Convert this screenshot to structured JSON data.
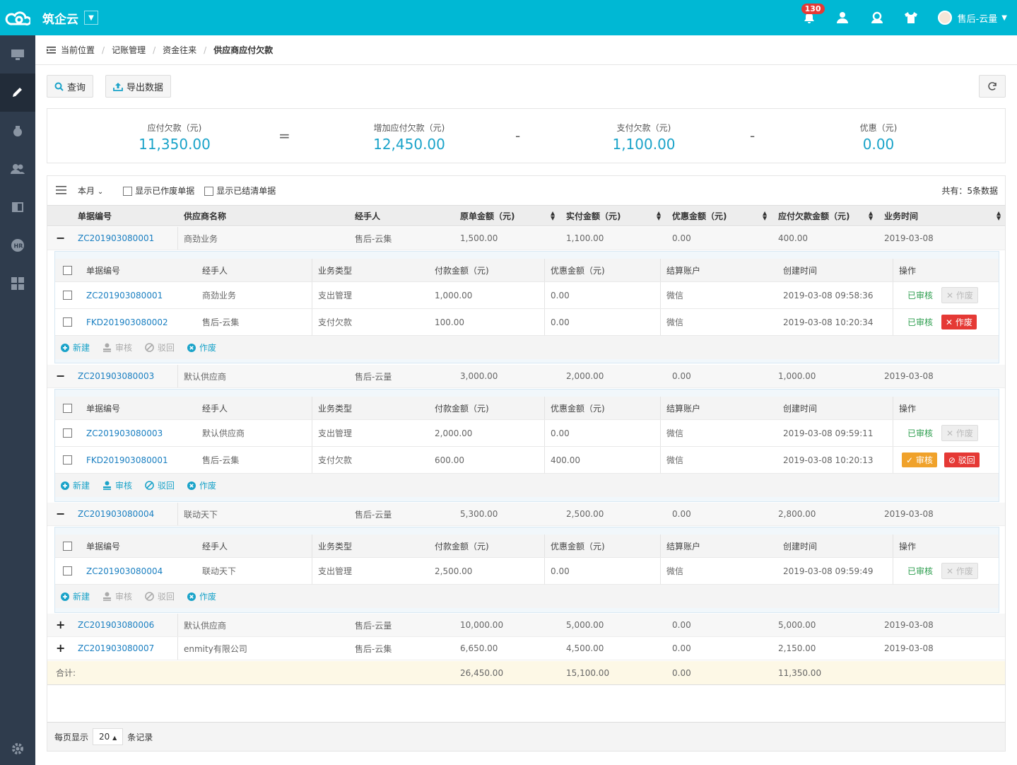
{
  "app": {
    "name": "筑企云",
    "notif_count": "130",
    "user": "售后-云量"
  },
  "breadcrumb": {
    "label": "当前位置",
    "items": [
      "记账管理",
      "资金往来",
      "供应商应付欠款"
    ]
  },
  "toolbar": {
    "query": "查询",
    "export": "导出数据"
  },
  "summary": {
    "payable": {
      "label": "应付欠款（元)",
      "value": "11,350.00"
    },
    "eq": "=",
    "increase": {
      "label": "增加应付欠款（元)",
      "value": "12,450.00"
    },
    "minus1": "-",
    "paid": {
      "label": "支付欠款（元)",
      "value": "1,100.00"
    },
    "minus2": "-",
    "discount": {
      "label": "优惠（元)",
      "value": "0.00"
    }
  },
  "filter": {
    "period": "本月",
    "show_void": "显示已作废单据",
    "show_settled": "显示已结清单据",
    "total": "共有：5条数据"
  },
  "columns": {
    "no": "单据编号",
    "supplier": "供应商名称",
    "handler": "经手人",
    "orig": "原单金额（元)",
    "paid": "实付金额（元)",
    "disc": "优惠金额（元)",
    "owe": "应付欠款金额（元)",
    "time": "业务时间"
  },
  "sub_columns": {
    "no": "单据编号",
    "handler": "经手人",
    "type": "业务类型",
    "amount": "付款金额（元)",
    "disc": "优惠金额（元)",
    "account": "结算账户",
    "created": "创建时间",
    "op": "操作"
  },
  "actions": {
    "new": "新建",
    "audit": "审核",
    "reject": "驳回",
    "void": "作废"
  },
  "ops": {
    "audited": "已审核",
    "void": "作废",
    "audit": "审核",
    "reject": "驳回"
  },
  "rows": [
    {
      "toggle": "−",
      "no": "ZC201903080001",
      "supplier": "商劲业务",
      "handler": "售后-云集",
      "orig": "1,500.00",
      "paid": "1,100.00",
      "disc": "0.00",
      "owe": "400.00",
      "time": "2019-03-08",
      "subs": [
        {
          "no": "ZC201903080001",
          "handler": "商劲业务",
          "type": "支出管理",
          "amount": "1,000.00",
          "disc": "0.00",
          "account": "微信",
          "created": "2019-03-08 09:58:36"
        },
        {
          "no": "FKD201903080002",
          "handler": "售后-云集",
          "type": "支付欠款",
          "amount": "100.00",
          "disc": "0.00",
          "account": "微信",
          "created": "2019-03-08 10:20:34"
        }
      ]
    },
    {
      "toggle": "−",
      "no": "ZC201903080003",
      "supplier": "默认供应商",
      "handler": "售后-云量",
      "orig": "3,000.00",
      "paid": "2,000.00",
      "disc": "0.00",
      "owe": "1,000.00",
      "time": "2019-03-08",
      "subs": [
        {
          "no": "ZC201903080003",
          "handler": "默认供应商",
          "type": "支出管理",
          "amount": "2,000.00",
          "disc": "0.00",
          "account": "微信",
          "created": "2019-03-08 09:59:11"
        },
        {
          "no": "FKD201903080001",
          "handler": "售后-云集",
          "type": "支付欠款",
          "amount": "600.00",
          "disc": "400.00",
          "account": "微信",
          "created": "2019-03-08 10:20:13"
        }
      ]
    },
    {
      "toggle": "−",
      "no": "ZC201903080004",
      "supplier": "联动天下",
      "handler": "售后-云量",
      "orig": "5,300.00",
      "paid": "2,500.00",
      "disc": "0.00",
      "owe": "2,800.00",
      "time": "2019-03-08",
      "subs": [
        {
          "no": "ZC201903080004",
          "handler": "联动天下",
          "type": "支出管理",
          "amount": "2,500.00",
          "disc": "0.00",
          "account": "微信",
          "created": "2019-03-08 09:59:49"
        }
      ]
    },
    {
      "toggle": "+",
      "no": "ZC201903080006",
      "supplier": "默认供应商",
      "handler": "售后-云量",
      "orig": "10,000.00",
      "paid": "5,000.00",
      "disc": "0.00",
      "owe": "5,000.00",
      "time": "2019-03-08"
    },
    {
      "toggle": "+",
      "no": "ZC201903080007",
      "supplier": "enmity有限公司",
      "handler": "售后-云集",
      "orig": "6,650.00",
      "paid": "4,500.00",
      "disc": "0.00",
      "owe": "2,150.00",
      "time": "2019-03-08"
    }
  ],
  "sum": {
    "label": "合计:",
    "orig": "26,450.00",
    "paid": "15,100.00",
    "disc": "0.00",
    "owe": "11,350.00"
  },
  "pager": {
    "prefix": "每页显示",
    "size": "20",
    "suffix": "条记录"
  },
  "colors": {
    "brand": "#00b8d4",
    "sidebar": "#2f3c4d",
    "link": "#1a7fc1"
  }
}
